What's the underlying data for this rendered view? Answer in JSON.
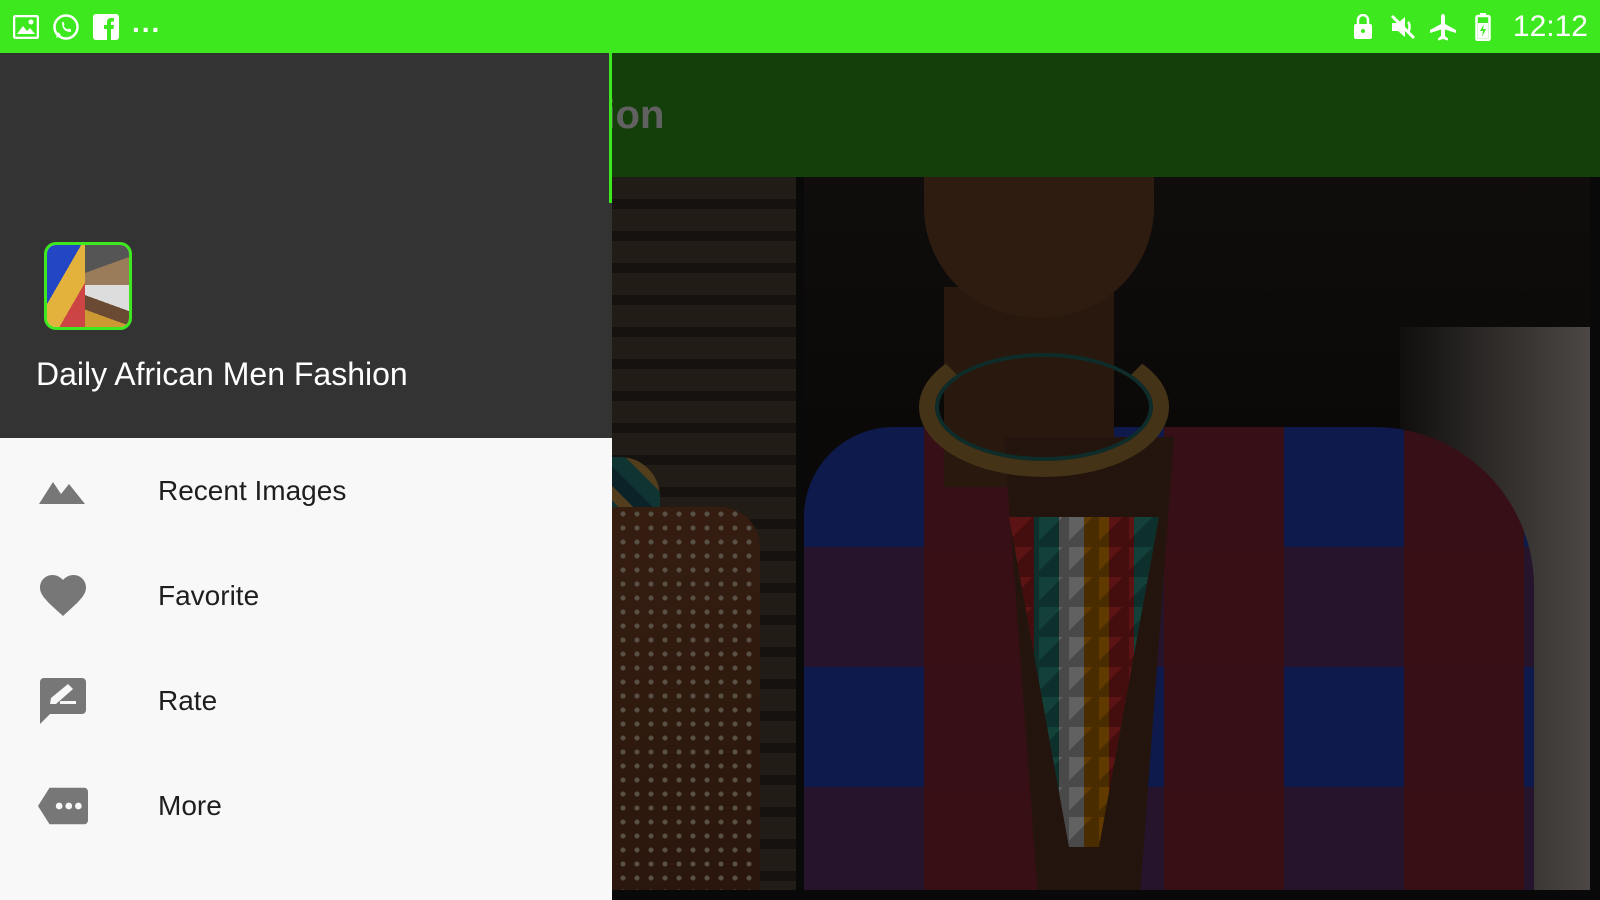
{
  "status_bar": {
    "left_icons": [
      "gallery-notification-icon",
      "whatsapp-icon",
      "facebook-icon"
    ],
    "more_indicator": "...",
    "right_icons": [
      "lock-icon",
      "mute-icon",
      "airplane-mode-icon",
      "battery-icon"
    ],
    "time": "12:12",
    "background_color": "#3ee81f"
  },
  "app_bar": {
    "title_visible_fragment": "hion"
  },
  "drawer": {
    "header": {
      "app_name": "Daily African Men Fashion",
      "background_color": "#333333"
    },
    "items": [
      {
        "icon": "landscape-icon",
        "label": "Recent Images"
      },
      {
        "icon": "heart-icon",
        "label": "Favorite"
      },
      {
        "icon": "rate-review-icon",
        "label": "Rate"
      },
      {
        "icon": "more-chat-icon",
        "label": "More"
      }
    ]
  }
}
